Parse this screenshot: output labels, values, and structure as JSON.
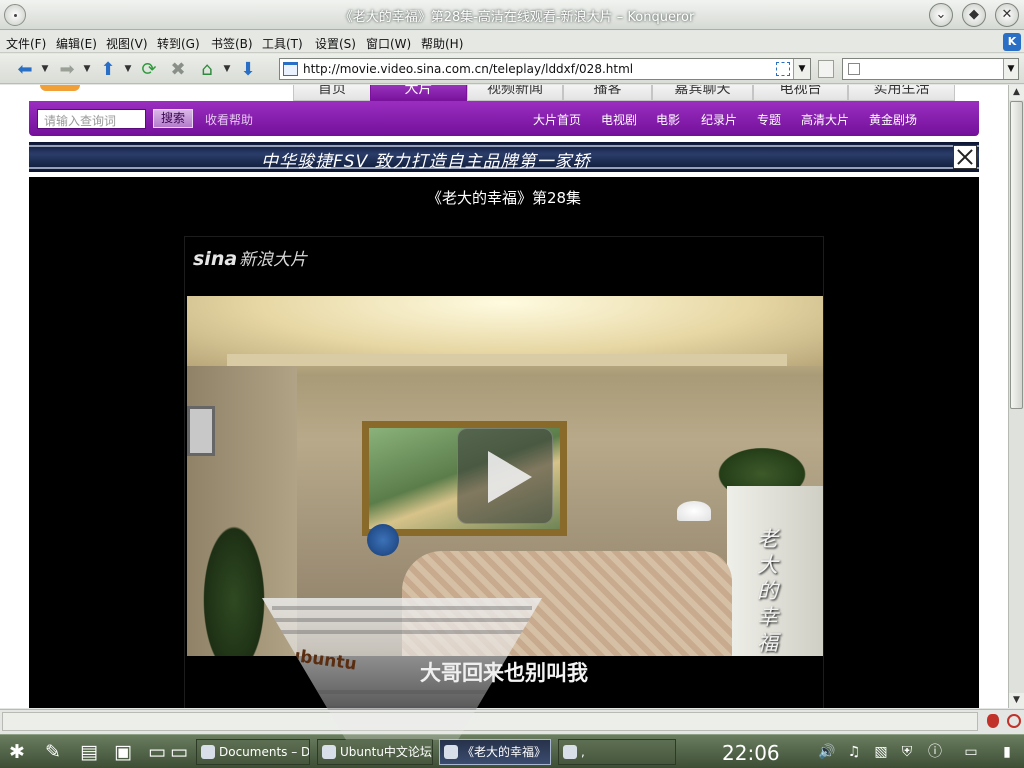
{
  "window": {
    "title": "《老大的幸福》第28集-高清在线观看-新浪大片 – Konqueror"
  },
  "menu": {
    "items": [
      "文件(F)",
      "编辑(E)",
      "视图(V)",
      "转到(G)",
      "书签(B)",
      "工具(T)",
      "设置(S)",
      "窗口(W)",
      "帮助(H)"
    ]
  },
  "toolbar": {
    "url": "http://movie.video.sina.com.cn/teleplay/lddxf/028.html",
    "search_value": ""
  },
  "site_nav": {
    "tabs": [
      "首页",
      "大片",
      "视频新闻",
      "播客",
      "嘉宾聊天",
      "电视台",
      "实用生活"
    ],
    "active_tab": "大片"
  },
  "search": {
    "placeholder": "请输入查询词",
    "button_label": "搜索",
    "help_link": "收看帮助"
  },
  "sub_links": [
    "大片首页",
    "电视剧",
    "电影",
    "纪录片",
    "专题",
    "高清大片",
    "黄金剧场"
  ],
  "ad": {
    "text": "中华骏捷FSV    致力打造自主品牌第一家轿"
  },
  "player": {
    "page_title": "《老大的幸福》第28集",
    "logo_brand": "sina",
    "logo_text": "新浪大片",
    "vertical_title": "老大的幸福",
    "subtitle": "大哥回来也别叫我"
  },
  "overlay": {
    "logo_text": "ubuntu"
  },
  "taskbar": {
    "tasks": [
      {
        "label": "Documents – D"
      },
      {
        "label": "Ubuntu中文论坛"
      },
      {
        "label": "《老大的幸福》"
      },
      {
        "label": ","
      }
    ],
    "clock": "22:06"
  }
}
